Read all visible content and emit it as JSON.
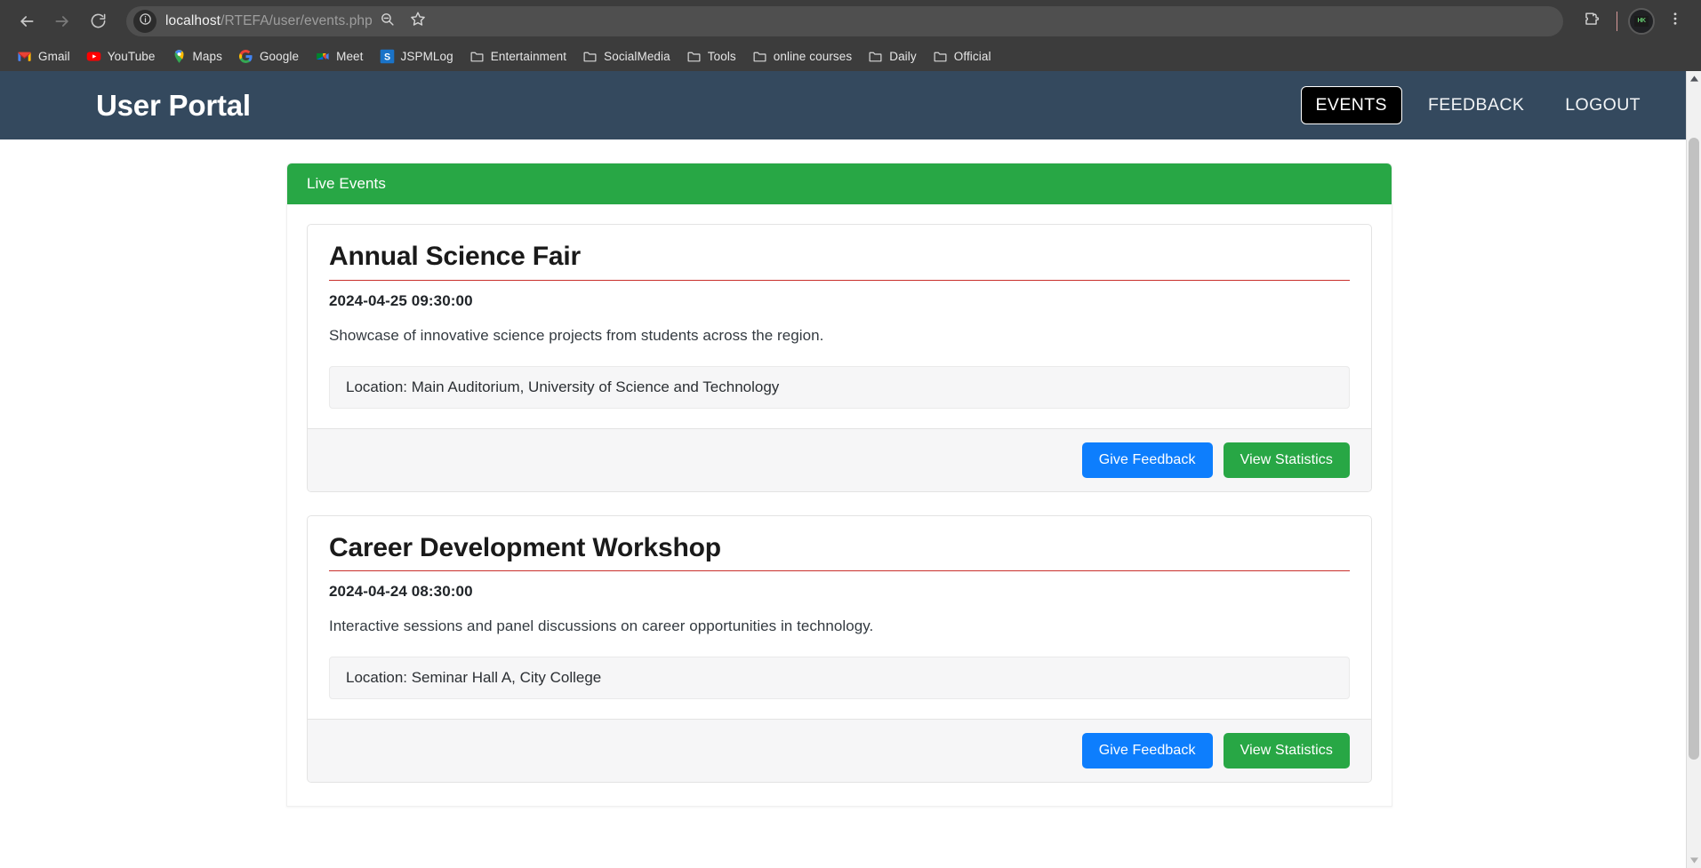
{
  "browser": {
    "back_icon": "back-arrow-icon",
    "forward_icon": "forward-arrow-icon",
    "reload_icon": "reload-icon",
    "site_info_icon": "info-circle-icon",
    "url_host": "localhost",
    "url_path": "/RTEFA/user/events.php",
    "url_full": "localhost/RTEFA/user/events.php",
    "zoom_icon": "search-zoom-icon",
    "bookmark_star_icon": "star-icon",
    "extensions_icon": "extensions-puzzle-icon",
    "profile_icon": "profile-avatar-icon",
    "menu_icon": "three-dot-menu-icon",
    "bookmarks": [
      {
        "label": "Gmail",
        "icon": "gmail-icon"
      },
      {
        "label": "YouTube",
        "icon": "youtube-icon"
      },
      {
        "label": "Maps",
        "icon": "maps-pin-icon"
      },
      {
        "label": "Google",
        "icon": "google-g-icon"
      },
      {
        "label": "Meet",
        "icon": "meet-icon"
      },
      {
        "label": "JSPMLog",
        "icon": "jspmlog-s-icon"
      },
      {
        "label": "Entertainment",
        "icon": "folder-icon"
      },
      {
        "label": "SocialMedia",
        "icon": "folder-icon"
      },
      {
        "label": "Tools",
        "icon": "folder-icon"
      },
      {
        "label": "online courses",
        "icon": "folder-icon"
      },
      {
        "label": "Daily",
        "icon": "folder-icon"
      },
      {
        "label": "Official",
        "icon": "folder-icon"
      }
    ]
  },
  "navbar": {
    "brand": "User Portal",
    "links": [
      {
        "label": "EVENTS",
        "active": true
      },
      {
        "label": "FEEDBACK",
        "active": false
      },
      {
        "label": "LOGOUT",
        "active": false
      }
    ]
  },
  "panel": {
    "header": "Live Events"
  },
  "events": [
    {
      "title": "Annual Science Fair",
      "date": "2024-04-25 09:30:00",
      "description": "Showcase of innovative science projects from students across the region.",
      "location": "Location: Main Auditorium, University of Science and Technology",
      "feedback_label": "Give Feedback",
      "stats_label": "View Statistics"
    },
    {
      "title": "Career Development Workshop",
      "date": "2024-04-24 08:30:00",
      "description": "Interactive sessions and panel discussions on career opportunities in technology.",
      "location": "Location: Seminar Hall A, City College",
      "feedback_label": "Give Feedback",
      "stats_label": "View Statistics"
    }
  ],
  "colors": {
    "navbar_bg": "#34495e",
    "panel_header_bg": "#28a745",
    "accent_underline": "#c9302c",
    "btn_feedback_bg": "#0d7efd",
    "btn_stats_bg": "#28a745",
    "chrome_bg": "#3c3c3c"
  }
}
